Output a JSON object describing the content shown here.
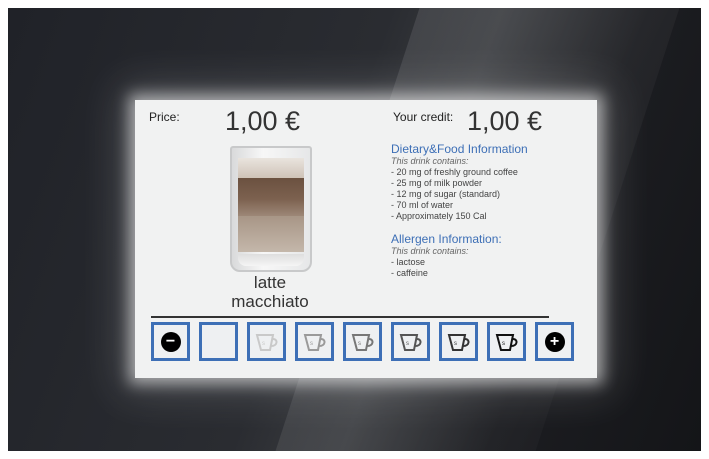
{
  "price": {
    "label": "Price:",
    "value": "1,00 €"
  },
  "credit": {
    "label": "Your credit:",
    "value": "1,00 €"
  },
  "drink": {
    "name_line1": "latte",
    "name_line2": "macchiato"
  },
  "dietary": {
    "title": "Dietary&Food Information",
    "subtitle": "This drink contains:",
    "items": [
      "- 20 mg of freshly ground coffee",
      "- 25 mg of milk powder",
      "- 12 mg of sugar (standard)",
      "- 70 ml of water",
      "- Approximately 150 Cal"
    ]
  },
  "allergen": {
    "title": "Allergen Information:",
    "subtitle": "This drink contains:",
    "items": [
      "- lactose",
      "- caffeine"
    ]
  },
  "sugar_control": {
    "minus_symbol": "−",
    "plus_symbol": "+",
    "cup_icon": "sugar-cup-icon",
    "accent_color": "#3d6fb6",
    "levels_total": 6,
    "selected_level": 0
  }
}
